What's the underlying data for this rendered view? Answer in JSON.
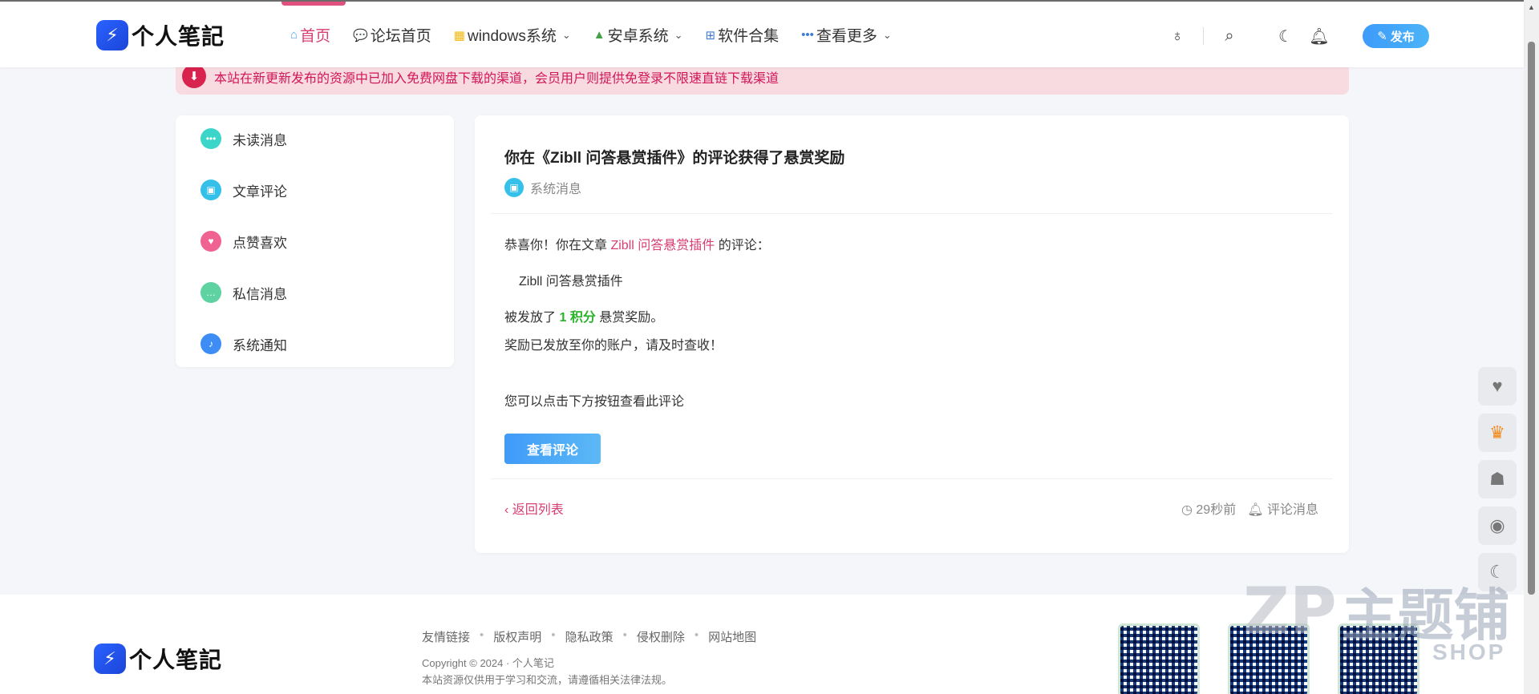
{
  "header": {
    "logo_text": "个人笔記",
    "nav": [
      {
        "label": "首页",
        "icon": "home-icon"
      },
      {
        "label": "论坛首页",
        "icon": "forum-icon"
      },
      {
        "label": "windows系统",
        "icon": "windows-icon"
      },
      {
        "label": "安卓系统",
        "icon": "android-icon"
      },
      {
        "label": "软件合集",
        "icon": "apps-icon"
      },
      {
        "label": "查看更多",
        "icon": "more-icon"
      }
    ],
    "publish_label": "发布"
  },
  "notice": {
    "text": "本站在新更新发布的资源中已加入免费网盘下载的渠道，会员用户则提供免登录不限速直链下载渠道"
  },
  "sidebar": {
    "items": [
      {
        "label": "未读消息",
        "icon": "unread-icon",
        "color": "#3cd5c9"
      },
      {
        "label": "文章评论",
        "icon": "comment-icon",
        "color": "#35c0ea"
      },
      {
        "label": "点赞喜欢",
        "icon": "heart-icon",
        "color": "#f06292"
      },
      {
        "label": "私信消息",
        "icon": "chat-icon",
        "color": "#5ed2a0"
      },
      {
        "label": "系统通知",
        "icon": "bell-icon",
        "color": "#3d8df5"
      }
    ]
  },
  "message": {
    "title": "你在《Zibll 问答悬赏插件》的评论获得了悬赏奖励",
    "category": "系统消息",
    "line1_prefix": "恭喜你！你在文章",
    "line1_link": "Zibll 问答悬赏插件",
    "line1_suffix": "的评论：",
    "quote": "Zibll 问答悬赏插件",
    "line2_prefix": "被发放了",
    "line2_points": "1 积分",
    "line2_suffix": "悬赏奖励。",
    "line3": "奖励已发放至你的账户，请及时查收！",
    "line4": "您可以点击下方按钮查看此评论",
    "button_label": "查看评论",
    "back_label": "返回列表",
    "time": "29秒前",
    "type_label": "评论消息"
  },
  "footer": {
    "logo_text": "个人笔記",
    "links": [
      "友情链接",
      "版权声明",
      "隐私政策",
      "侵权删除",
      "网站地图"
    ],
    "copyright": "Copyright © 2024 · 个人笔记",
    "note": "本站资源仅供用于学习和交流，请遵循相关法律法规。"
  },
  "watermark": {
    "text": "主题铺",
    "shop": "SHOP"
  }
}
